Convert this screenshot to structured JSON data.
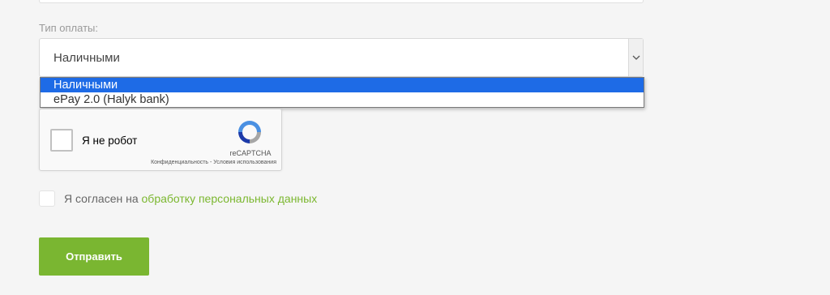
{
  "form": {
    "payment_label": "Тип оплаты:",
    "payment_select": {
      "value": "Наличными",
      "options": [
        "Наличными",
        "ePay 2.0 (Halyk bank)"
      ],
      "selected_index": 0
    },
    "recaptcha": {
      "label": "Я не робот",
      "brand": "reCAPTCHA",
      "links": "Конфиденциальность - Условия использования"
    },
    "consent": {
      "prefix": "Я согласен на",
      "link": "обработку персональных данных"
    },
    "submit_label": "Отправить"
  },
  "colors": {
    "accent_green": "#7ab631",
    "option_highlight": "#1e6be6"
  }
}
